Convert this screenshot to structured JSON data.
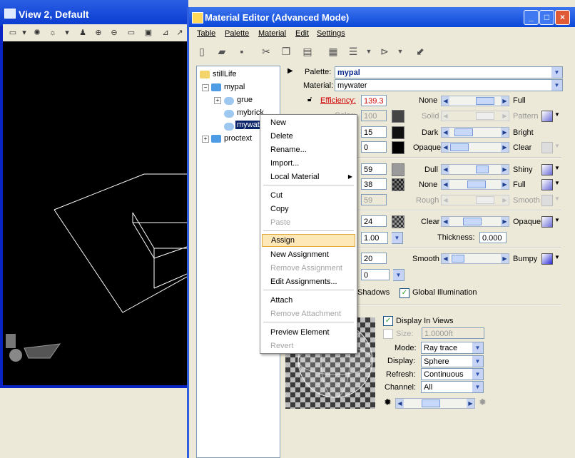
{
  "view_window": {
    "title": "View 2, Default"
  },
  "editor": {
    "title": "Material Editor (Advanced Mode)",
    "window_buttons": {
      "minimize": "_",
      "maximize": "□",
      "close": "×"
    },
    "menus": [
      "Table",
      "Palette",
      "Material",
      "Edit",
      "Settings"
    ],
    "tree": {
      "root": "stillLife",
      "palette": "mypal",
      "items": [
        "grue",
        "mybrick",
        "mywater"
      ],
      "other": "proctext"
    },
    "palette_label": "Palette:",
    "palette_value": "mypal",
    "material_label": "Material:",
    "material_value": "mywater",
    "efficiency_label": "Efficiency:",
    "rows": [
      {
        "value": "139.3",
        "left": "None",
        "right": "Full"
      },
      {
        "label": "Color:",
        "value": "100",
        "left": "Solid",
        "right": "Pattern"
      },
      {
        "value": "15",
        "left": "Dark",
        "right": "Bright"
      },
      {
        "value": "0",
        "left": "Opaque",
        "right": "Clear"
      },
      {
        "value": "59",
        "left": "Dull",
        "right": "Shiny"
      },
      {
        "value": "38",
        "left": "None",
        "right": "Full"
      },
      {
        "value": "59",
        "left": "Rough",
        "right": "Smooth"
      },
      {
        "value": "24",
        "left": "Clear",
        "right": "Opaque"
      },
      {
        "value": "1.00",
        "thickness_label": "Thickness:",
        "thickness_value": "0.000"
      },
      {
        "value": "20",
        "left": "Smooth",
        "right": "Bumpy"
      },
      {
        "value": "0"
      }
    ],
    "shadows_label": "Shadows",
    "gi_label": "Global Illumination",
    "display_in_views": "Display In Views",
    "size_label": "Size:",
    "size_value": "1.0000ft",
    "mode_label": "Mode:",
    "mode_value": "Ray trace",
    "display_label": "Display:",
    "display_value": "Sphere",
    "refresh_label": "Refresh:",
    "refresh_value": "Continuous",
    "channel_label": "Channel:",
    "channel_value": "All"
  },
  "context_menu": {
    "items": [
      {
        "label": "New",
        "enabled": true
      },
      {
        "label": "Delete",
        "enabled": true
      },
      {
        "label": "Rename...",
        "enabled": true
      },
      {
        "label": "Import...",
        "enabled": true
      },
      {
        "label": "Local Material",
        "enabled": true,
        "submenu": true
      },
      {
        "label": "Cut",
        "enabled": true
      },
      {
        "label": "Copy",
        "enabled": true
      },
      {
        "label": "Paste",
        "enabled": false
      },
      {
        "label": "Assign",
        "enabled": true,
        "highlighted": true
      },
      {
        "label": "New Assignment",
        "enabled": true
      },
      {
        "label": "Remove Assignment",
        "enabled": false
      },
      {
        "label": "Edit Assignments...",
        "enabled": true
      },
      {
        "label": "Attach",
        "enabled": true
      },
      {
        "label": "Remove Attachment",
        "enabled": false
      },
      {
        "label": "Preview Element",
        "enabled": true
      },
      {
        "label": "Revert",
        "enabled": false
      }
    ]
  },
  "colors": {
    "efficiency": "#cc0000",
    "selection": "#0a246a",
    "highlight": "#ffe8b8"
  }
}
